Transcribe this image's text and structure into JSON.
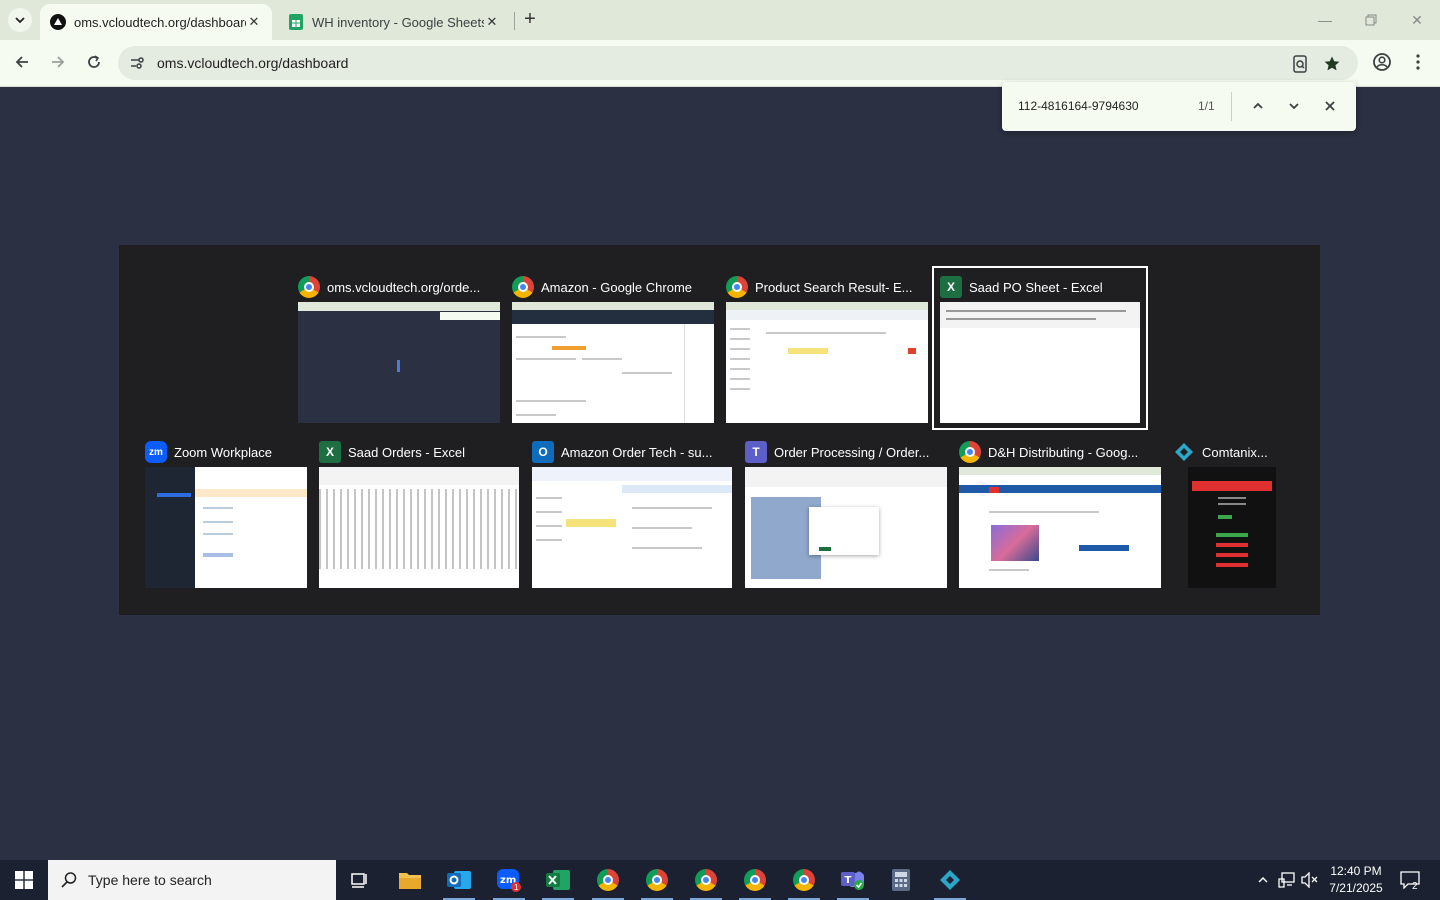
{
  "browser": {
    "tabs": [
      {
        "label": "oms.vcloudtech.org/dashboard",
        "active": true,
        "icon": "vercel-triangle-icon"
      },
      {
        "label": "WH inventory - Google Sheets",
        "active": false,
        "icon": "google-sheets-icon"
      }
    ],
    "url": "oms.vcloudtech.org/dashboard"
  },
  "find_bar": {
    "query": "112-4816164-9794630",
    "count": "1/1"
  },
  "switcher": {
    "windows": [
      {
        "title": "oms.vcloudtech.org/orde...",
        "app": "chrome"
      },
      {
        "title": "Amazon - Google Chrome",
        "app": "chrome"
      },
      {
        "title": "Product Search Result- E...",
        "app": "chrome"
      },
      {
        "title": "Saad PO Sheet - Excel",
        "app": "excel",
        "selected": true
      },
      {
        "title": "Zoom Workplace",
        "app": "zoom"
      },
      {
        "title": "Saad Orders - Excel",
        "app": "excel"
      },
      {
        "title": "Amazon Order Tech - su...",
        "app": "outlook"
      },
      {
        "title": "Order Processing / Order...",
        "app": "teams"
      },
      {
        "title": "D&H Distributing - Goog...",
        "app": "chrome"
      },
      {
        "title": "Comtanix...",
        "app": "comtanix"
      }
    ]
  },
  "taskbar": {
    "search_placeholder": "Type here to search",
    "time": "12:40 PM",
    "date": "7/21/2025",
    "notification_count": "2",
    "zoom_badge": "1"
  },
  "colors": {
    "page_bg": "#2b3042",
    "tabstrip": "#dfe8d9",
    "toolbar": "#f6fbf2",
    "switcher_bg": "#1f1f22",
    "taskbar": "#1b2130",
    "excel_green": "#1d6f42",
    "zoom_blue": "#0b5cff"
  }
}
